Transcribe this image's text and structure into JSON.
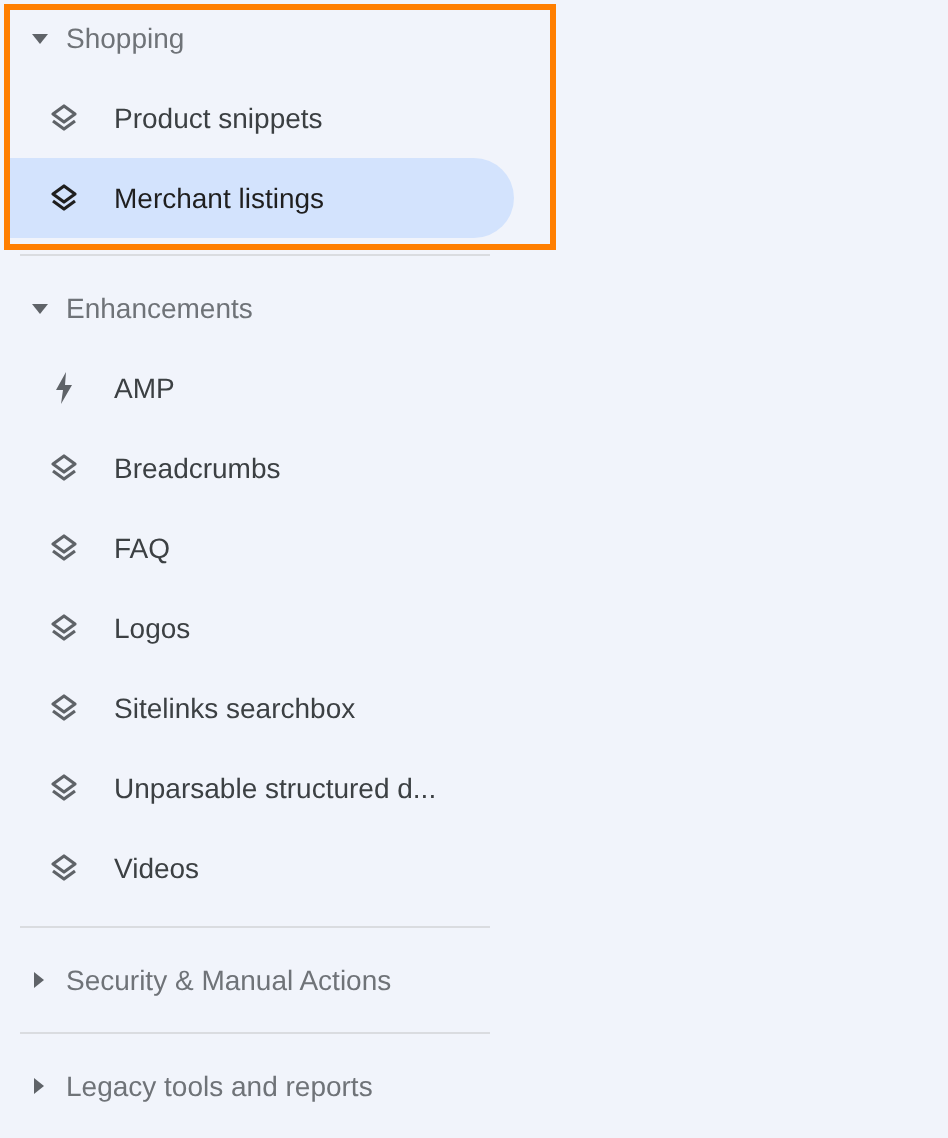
{
  "sections": [
    {
      "title": "Shopping",
      "expanded": true,
      "highlighted": true,
      "items": [
        {
          "label": "Product snippets",
          "kind": "layers",
          "selected": false
        },
        {
          "label": "Merchant listings",
          "kind": "layers",
          "selected": true
        }
      ]
    },
    {
      "title": "Enhancements",
      "expanded": true,
      "highlighted": false,
      "items": [
        {
          "label": "AMP",
          "kind": "bolt",
          "selected": false
        },
        {
          "label": "Breadcrumbs",
          "kind": "layers",
          "selected": false
        },
        {
          "label": "FAQ",
          "kind": "layers",
          "selected": false
        },
        {
          "label": "Logos",
          "kind": "layers",
          "selected": false
        },
        {
          "label": "Sitelinks searchbox",
          "kind": "layers",
          "selected": false
        },
        {
          "label": "Unparsable structured d...",
          "kind": "layers",
          "selected": false
        },
        {
          "label": "Videos",
          "kind": "layers",
          "selected": false
        }
      ]
    },
    {
      "title": "Security & Manual Actions",
      "expanded": false,
      "highlighted": false
    },
    {
      "title": "Legacy tools and reports",
      "expanded": false,
      "highlighted": false
    }
  ]
}
